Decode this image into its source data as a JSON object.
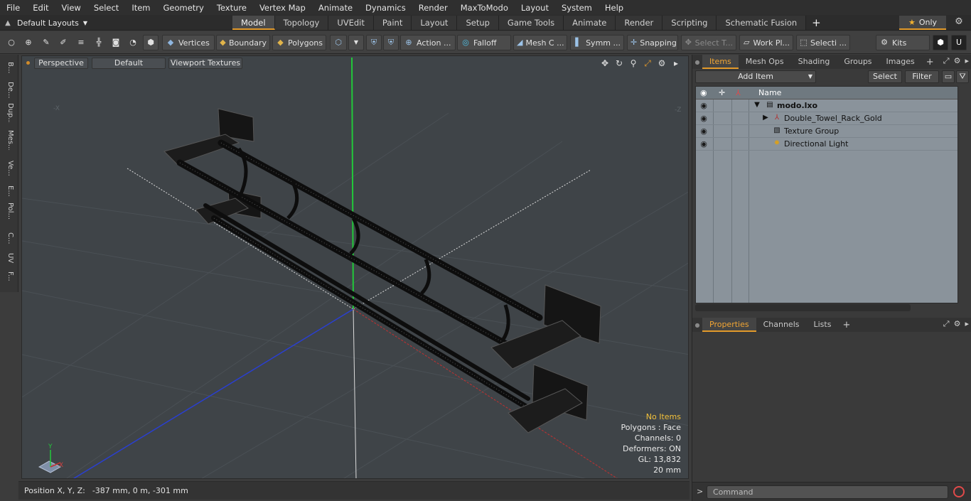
{
  "menu": [
    "File",
    "Edit",
    "View",
    "Select",
    "Item",
    "Geometry",
    "Texture",
    "Vertex Map",
    "Animate",
    "Dynamics",
    "Render",
    "MaxToModo",
    "Layout",
    "System",
    "Help"
  ],
  "layout_selector": "Default Layouts",
  "tabs": [
    {
      "label": "Model",
      "active": true
    },
    {
      "label": "Topology",
      "active": false
    },
    {
      "label": "UVEdit",
      "active": false
    },
    {
      "label": "Paint",
      "active": false
    },
    {
      "label": "Layout",
      "active": false
    },
    {
      "label": "Setup",
      "active": false
    },
    {
      "label": "Game Tools",
      "active": false
    },
    {
      "label": "Animate",
      "active": false
    },
    {
      "label": "Render",
      "active": false
    },
    {
      "label": "Scripting",
      "active": false
    },
    {
      "label": "Schematic Fusion",
      "active": false
    }
  ],
  "only_label": "Only",
  "toolbar": {
    "vertices": "Vertices",
    "boundary": "Boundary",
    "polygons": "Polygons",
    "action": "Action ...",
    "falloff": "Falloff",
    "meshc": "Mesh C ...",
    "symm": "Symm ...",
    "snapping": "Snapping",
    "select_t": "Select T...",
    "work_pl": "Work Pl...",
    "selecti": "Selecti ...",
    "kits": "Kits"
  },
  "left_tabs": [
    "B...",
    "De...",
    "Dup...",
    "Mes...",
    "Ve...",
    "E...",
    "Pol...",
    "C...",
    "UV",
    "F..."
  ],
  "viewport": {
    "mode": "Perspective",
    "shading": "Default",
    "textures": "Viewport Textures",
    "stats": {
      "no_items": "No Items",
      "polygons": "Polygons : Face",
      "channels": "Channels: 0",
      "deformers": "Deformers: ON",
      "gl": "GL: 13,832",
      "scale": "20 mm"
    },
    "axis_labels": {
      "y": "Y",
      "x": "X"
    },
    "corner_labels": {
      "left": "-X",
      "right": "-Z"
    }
  },
  "position_bar": {
    "label": "Position X, Y, Z:",
    "value": "-387 mm, 0 m, -301 mm"
  },
  "items_panel": {
    "tabs": [
      {
        "label": "Items",
        "active": true
      },
      {
        "label": "Mesh Ops",
        "active": false
      },
      {
        "label": "Shading",
        "active": false
      },
      {
        "label": "Groups",
        "active": false
      },
      {
        "label": "Images",
        "active": false
      }
    ],
    "add_item": "Add Item",
    "select": "Select",
    "filter": "Filter",
    "column_name": "Name",
    "rows": [
      {
        "label": "modo.lxo",
        "icon": "scene-icon"
      },
      {
        "label": "Double_Towel_Rack_Gold",
        "icon": "mesh-icon"
      },
      {
        "label": "Texture Group",
        "icon": "texture-group-icon"
      },
      {
        "label": "Directional Light",
        "icon": "light-icon"
      }
    ]
  },
  "properties_panel": {
    "tabs": [
      {
        "label": "Properties",
        "active": true
      },
      {
        "label": "Channels",
        "active": false
      },
      {
        "label": "Lists",
        "active": false
      }
    ]
  },
  "command_placeholder": "Command",
  "colors": {
    "accent": "#e39a2a",
    "viewport_bg": "#3f4448",
    "tree_bg": "#8a939b",
    "axis_y": "#22c83a",
    "axis_z": "#2a3fd0",
    "axis_x": "#c23030"
  }
}
